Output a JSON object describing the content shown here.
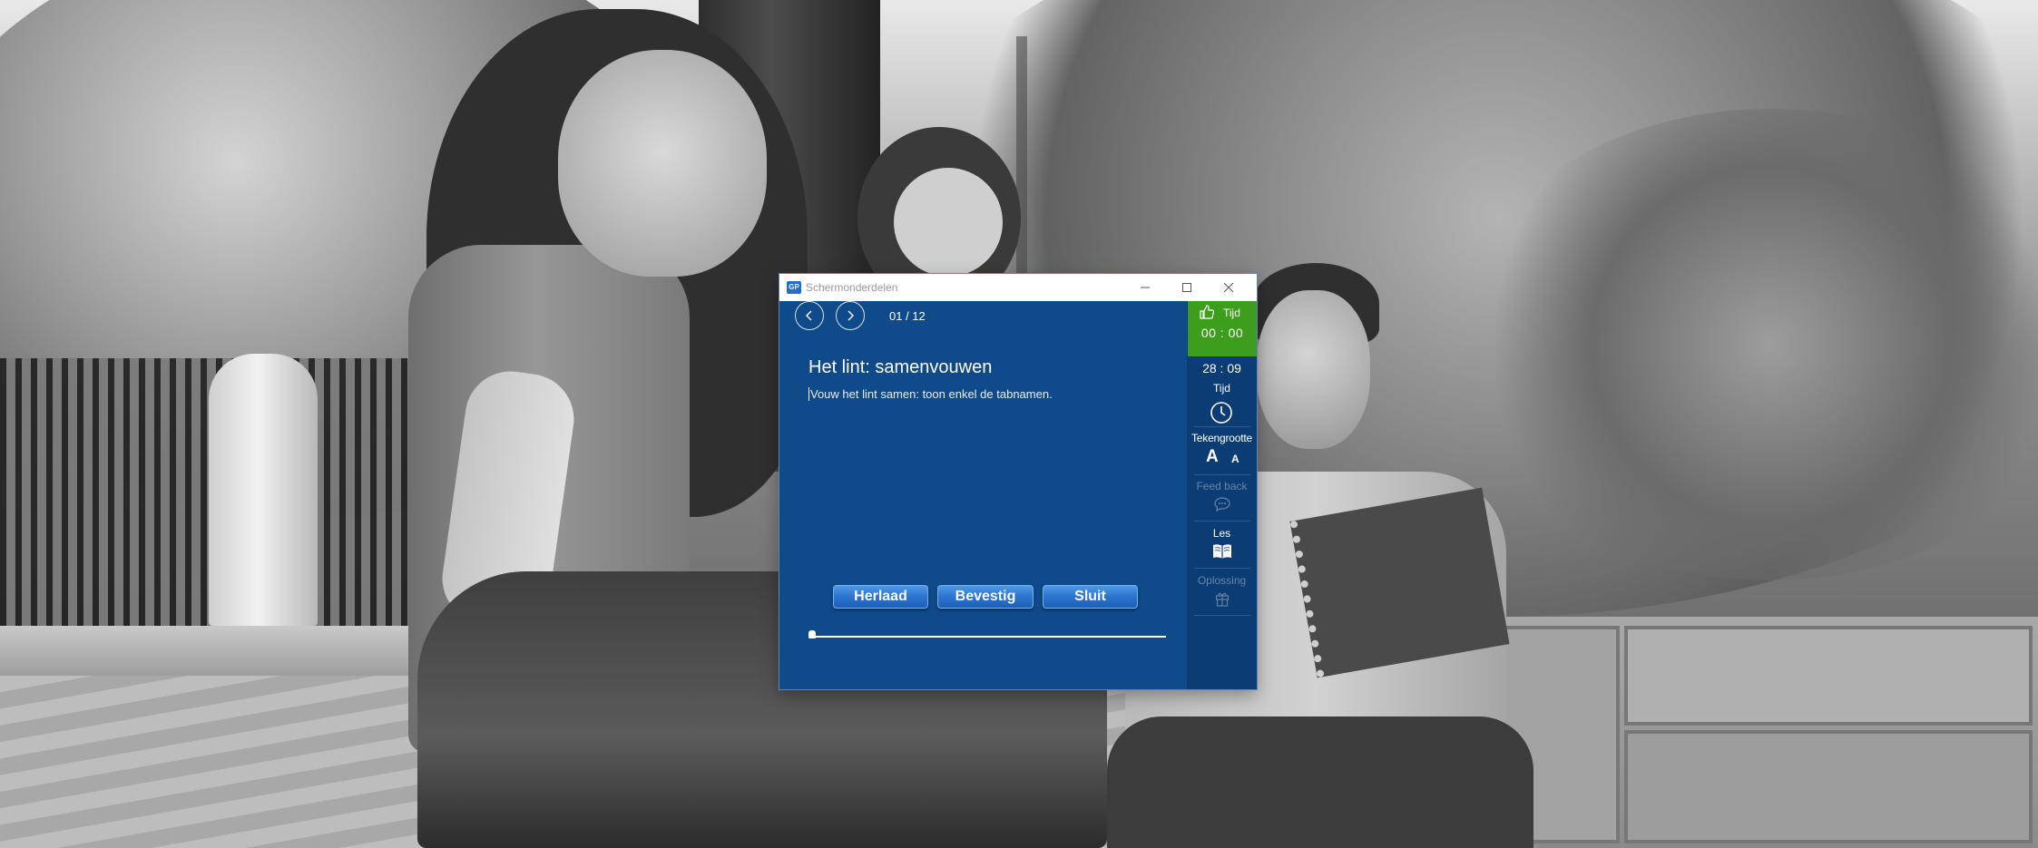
{
  "window": {
    "title": "Schermonderdelen",
    "logo_text": "GP"
  },
  "navigation": {
    "page_counter": "01 / 12"
  },
  "lesson": {
    "title": "Het lint: samenvouwen",
    "instruction": "Vouw het lint samen: toon enkel de tabnamen."
  },
  "buttons": {
    "reload": "Herlaad",
    "confirm": "Bevestig",
    "close": "Sluit"
  },
  "progress": {
    "fraction": 0.0
  },
  "side_panel": {
    "timer_label": "Tijd",
    "timer_value": "00 : 00",
    "remaining_time": "28 : 09",
    "time_label": "Tijd",
    "font_size_label": "Tekengrootte",
    "font_large": "A",
    "font_small": "A",
    "feedback_label": "Feed back",
    "lesson_label": "Les",
    "solution_label": "Oplossing"
  },
  "colors": {
    "window_background": "#0f4a8a",
    "side_panel_background": "#0b3c74",
    "timer_background": "#3d9e1e",
    "button_blue": "#2b74cf",
    "disabled_text": "#6785a8"
  },
  "icons": [
    "app-logo-icon",
    "chevron-left-icon",
    "chevron-right-icon",
    "thumbs-up-icon",
    "clock-icon",
    "speech-bubble-icon",
    "open-book-icon",
    "gift-icon",
    "minimize-icon",
    "maximize-icon",
    "close-icon"
  ]
}
